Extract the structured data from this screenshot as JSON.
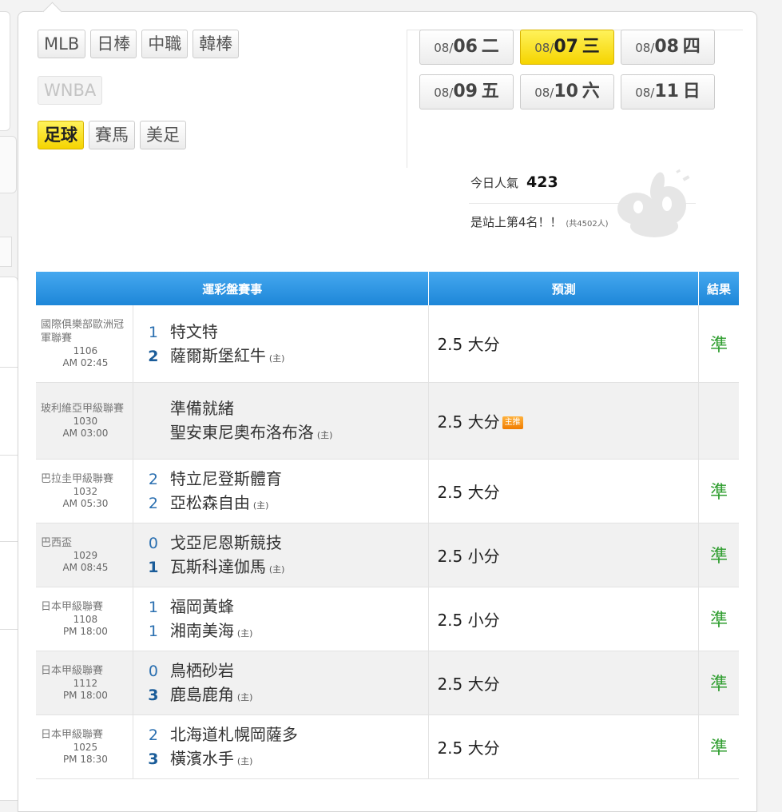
{
  "sports": {
    "row1": [
      "MLB",
      "日棒",
      "中職",
      "韓棒"
    ],
    "row2": [
      "WNBA"
    ],
    "row3": [
      "足球",
      "賽馬",
      "美足"
    ],
    "active": "足球",
    "disabled": "WNBA"
  },
  "dates": [
    {
      "md": "08/",
      "day": "06",
      "wd": "二",
      "active": false
    },
    {
      "md": "08/",
      "day": "07",
      "wd": "三",
      "active": true
    },
    {
      "md": "08/",
      "day": "08",
      "wd": "四",
      "active": false
    },
    {
      "md": "08/",
      "day": "09",
      "wd": "五",
      "active": false
    },
    {
      "md": "08/",
      "day": "10",
      "wd": "六",
      "active": false
    },
    {
      "md": "08/",
      "day": "11",
      "wd": "日",
      "active": false
    }
  ],
  "popularity": {
    "label": "今日人氣",
    "value": "423",
    "rank_text": "是站上第4名！！",
    "rank_total": "(共4502人)"
  },
  "table": {
    "headers": [
      "運彩盤賽事",
      "預測",
      "結果"
    ],
    "home_tag": "(主)",
    "badge_label": "主推",
    "rows": [
      {
        "league": "國際俱樂部歐洲冠軍聯賽",
        "code": "1106",
        "time": "AM 02:45",
        "away_score": "1",
        "away": "特文特",
        "home_score": "2",
        "home": "薩爾斯堡紅牛",
        "prediction": "2.5 大分",
        "badge": false,
        "result": "準"
      },
      {
        "league": "玻利維亞甲級聯賽",
        "code": "1030",
        "time": "AM 03:00",
        "away_score": "",
        "away": "準備就緒",
        "home_score": "",
        "home": "聖安東尼奧布洛布洛",
        "prediction": "2.5 大分",
        "badge": true,
        "result": ""
      },
      {
        "league": "巴拉圭甲級聯賽",
        "code": "1032",
        "time": "AM 05:30",
        "away_score": "2",
        "away": "特立尼登斯體育",
        "home_score": "2",
        "home": "亞松森自由",
        "prediction": "2.5 大分",
        "badge": false,
        "result": "準"
      },
      {
        "league": "巴西盃",
        "code": "1029",
        "time": "AM 08:45",
        "away_score": "0",
        "away": "戈亞尼恩斯競技",
        "home_score": "1",
        "home": "瓦斯科達伽馬",
        "prediction": "2.5 小分",
        "badge": false,
        "result": "準"
      },
      {
        "league": "日本甲級聯賽",
        "code": "1108",
        "time": "PM 18:00",
        "away_score": "1",
        "away": "福岡黃蜂",
        "home_score": "1",
        "home": "湘南美海",
        "prediction": "2.5 小分",
        "badge": false,
        "result": "準"
      },
      {
        "league": "日本甲級聯賽",
        "code": "1112",
        "time": "PM 18:00",
        "away_score": "0",
        "away": "鳥栖砂岩",
        "home_score": "3",
        "home": "鹿島鹿角",
        "prediction": "2.5 大分",
        "badge": false,
        "result": "準"
      },
      {
        "league": "日本甲級聯賽",
        "code": "1025",
        "time": "PM 18:30",
        "away_score": "2",
        "away": "北海道札幌岡薩多",
        "home_score": "3",
        "home": "橫濱水手",
        "prediction": "2.5 大分",
        "badge": false,
        "result": "準"
      }
    ]
  },
  "colors": {
    "header_blue": "#1d86d8",
    "active_yellow": "#f5d400",
    "result_green": "#2e9d2e",
    "score_blue": "#2a6fb0"
  }
}
